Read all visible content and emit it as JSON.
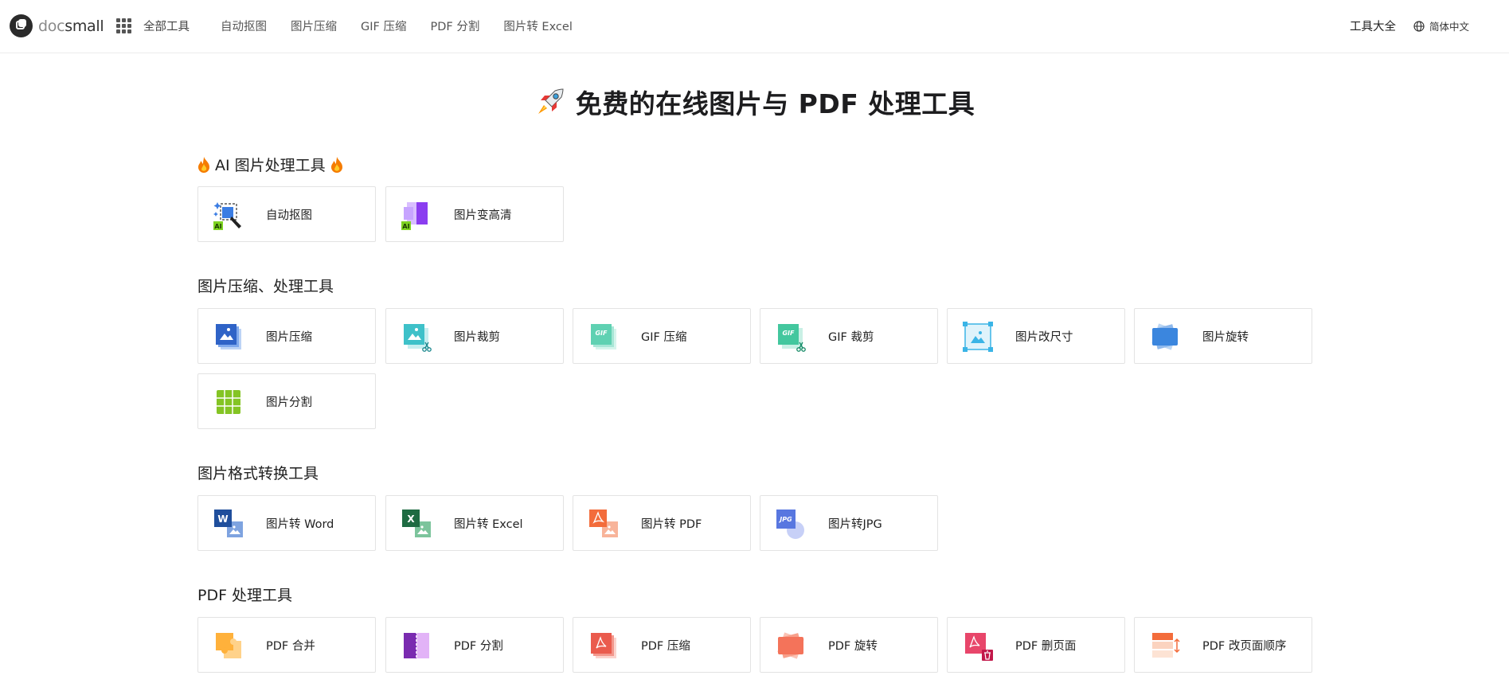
{
  "brand": {
    "prefix": "doc",
    "suffix": "small"
  },
  "nav": {
    "all_tools": "全部工具",
    "links": [
      "自动抠图",
      "图片压缩",
      "GIF 压缩",
      "PDF 分割",
      "图片转 Excel"
    ],
    "tools_all": "工具大全",
    "language": "简体中文"
  },
  "page_title": "免费的在线图片与 PDF 处理工具",
  "sections": {
    "ai": {
      "title": "AI 图片处理工具",
      "items": [
        "自动抠图",
        "图片变高清"
      ]
    },
    "compress": {
      "title": "图片压缩、处理工具",
      "items": [
        "图片压缩",
        "图片裁剪",
        "GIF 压缩",
        "GIF 裁剪",
        "图片改尺寸",
        "图片旋转",
        "图片分割"
      ]
    },
    "convert": {
      "title": "图片格式转换工具",
      "items": [
        "图片转 Word",
        "图片转 Excel",
        "图片转 PDF",
        "图片转JPG"
      ]
    },
    "pdf": {
      "title": "PDF 处理工具",
      "items": [
        "PDF 合并",
        "PDF 分割",
        "PDF 压缩",
        "PDF 旋转",
        "PDF 删页面",
        "PDF 改页面顺序"
      ]
    }
  },
  "icon_text": {
    "ai": "AI",
    "gif": "GIF",
    "word": "W",
    "excel": "X",
    "jpg": "JPG"
  },
  "colors": {
    "ai_badge": "#7ed321",
    "blue": "#3b7de3",
    "purple": "#8b3df0",
    "teal": "#3ec1c9",
    "mint": "#5fd1b2",
    "word": "#2b5797",
    "excel": "#1e7145",
    "pdf_orange": "#f36c3b",
    "grid_green": "#84c424",
    "pdf_red": "#ea5b4d",
    "pdf_pink": "#e8466a"
  }
}
